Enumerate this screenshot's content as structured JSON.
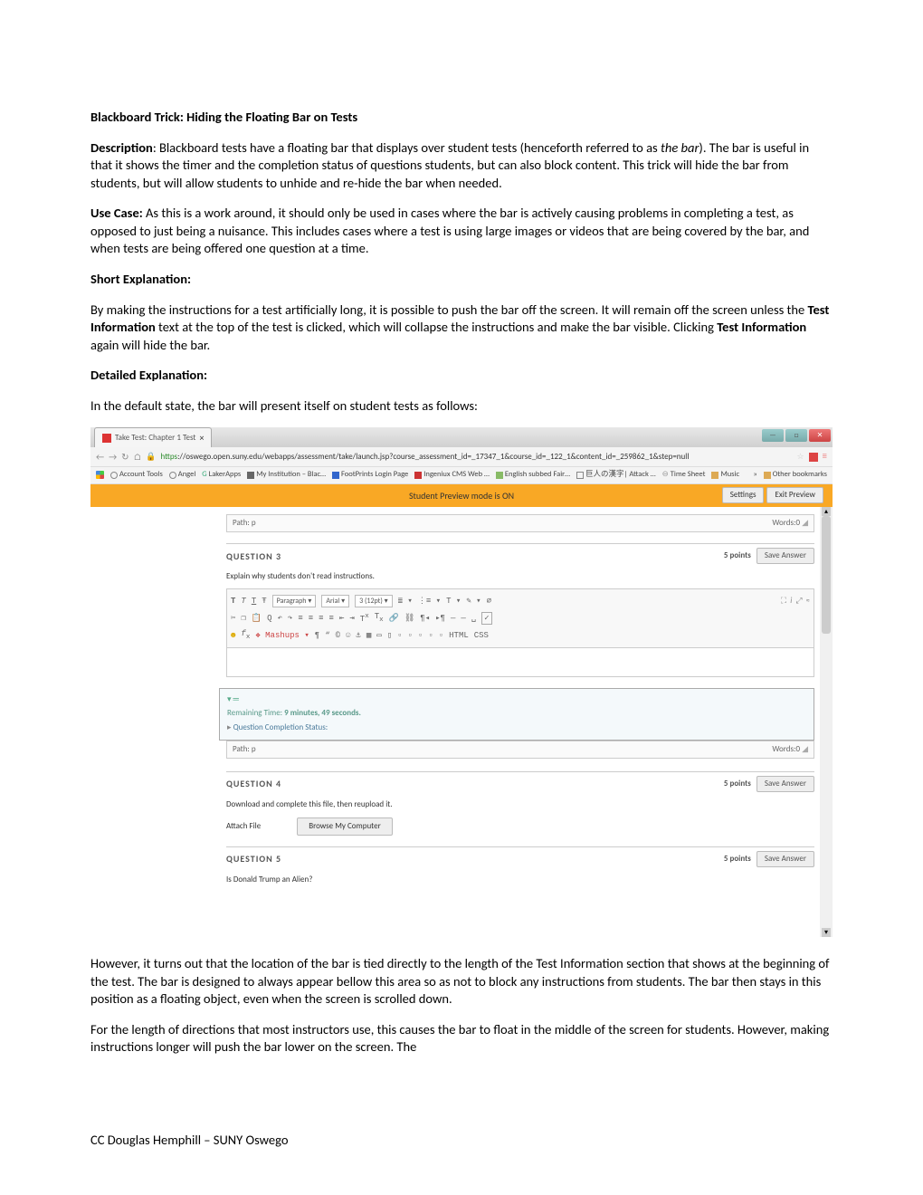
{
  "doc": {
    "title": "Blackboard Trick: Hiding the Floating Bar on Tests",
    "desc_label": "Description",
    "desc_text": ":  Blackboard tests have a floating bar that displays over student tests (henceforth referred to as ",
    "desc_italic": "the bar",
    "desc_text2": ").  The bar is useful in that it shows the timer and the completion status of questions students, but can also block content.  This trick will hide the bar from students, but will allow students to unhide and re-hide the bar when needed.",
    "usecase_label": "Use Case:",
    "usecase_text": "  As this is a work around, it should only be used in cases where the bar is actively causing problems in completing a test, as opposed to just being a nuisance.  This includes cases where a test is using large images or videos that are being covered by the bar, and when tests are being offered one question at a time.",
    "short_exp_label": "Short Explanation:",
    "short_exp_text_1": "By making the instructions for a test artificially long, it is possible to push the bar off the screen.  It will remain off the screen unless the ",
    "short_exp_bold_1": "Test Information",
    "short_exp_text_2": " text at the top of the test is clicked, which will collapse the instructions and make the bar visible.  Clicking ",
    "short_exp_bold_2": "Test Information",
    "short_exp_text_3": " again will hide the bar.",
    "detailed_label": "Detailed Explanation:",
    "detailed_intro": "In the default state, the bar will present itself on student tests as follows:",
    "post_img_p1": "However, it turns out that the location of the bar is tied directly to the length of the Test Information section that shows at the beginning of the test.  The bar is designed to always appear bellow this area so as not to block any instructions from students.  The bar then stays in this position as a floating object, even when the screen is scrolled down.",
    "post_img_p2": "For the length of directions that most instructors use, this causes the bar to float in the middle of the screen for students.  However, making instructions longer will push the bar lower on the screen.  The",
    "footer": "CC Douglas Hemphill – SUNY Oswego"
  },
  "screenshot": {
    "tab_title": "Take Test: Chapter 1 Test",
    "url_green": "https",
    "url_rest": "://oswego.open.suny.edu/webapps/assessment/take/launch.jsp?course_assessment_id=_17347_1&course_id=_122_1&content_id=_259862_1&step=null",
    "bookmarks": {
      "b1": "Account Tools",
      "b2": "Angel",
      "b3": "LakerApps",
      "b4": "My Institution – Blac…",
      "b5": "FootPrints Login Page",
      "b6": "Ingeniux CMS Web …",
      "b7": "English subbed Fair…",
      "b8": "巨人の漢字| Attack …",
      "b9": "Time Sheet",
      "b10": "Music",
      "other": "Other bookmarks"
    },
    "preview_text": "Student Preview mode is ON",
    "preview_settings": "Settings",
    "preview_exit": "Exit Preview",
    "path_label": "Path: p",
    "words_label": "Words:0",
    "q3": {
      "title": "QUESTION 3",
      "points": "5 points",
      "save": "Save Answer",
      "prompt": "Explain why students don't read instructions."
    },
    "toolbar": {
      "paragraph": "Paragraph",
      "font": "Arial",
      "size": "3 (12pt)",
      "mashups": "Mashups",
      "html": "HTML",
      "css": "CSS"
    },
    "floating": {
      "remaining": "Remaining Time: ",
      "remaining_bold": "9 minutes, 49 seconds.",
      "qcs": "Question Completion Status:"
    },
    "path2_label": "Path: p",
    "words2_label": "Words:0",
    "q4": {
      "title": "QUESTION 4",
      "points": "5 points",
      "save": "Save Answer",
      "prompt": "Download and complete this file, then reupload it.",
      "attach": "Attach File",
      "browse": "Browse My Computer"
    },
    "q5": {
      "title": "QUESTION 5",
      "points": "5 points",
      "save": "Save Answer",
      "prompt": "Is Donald Trump an Alien?"
    }
  }
}
